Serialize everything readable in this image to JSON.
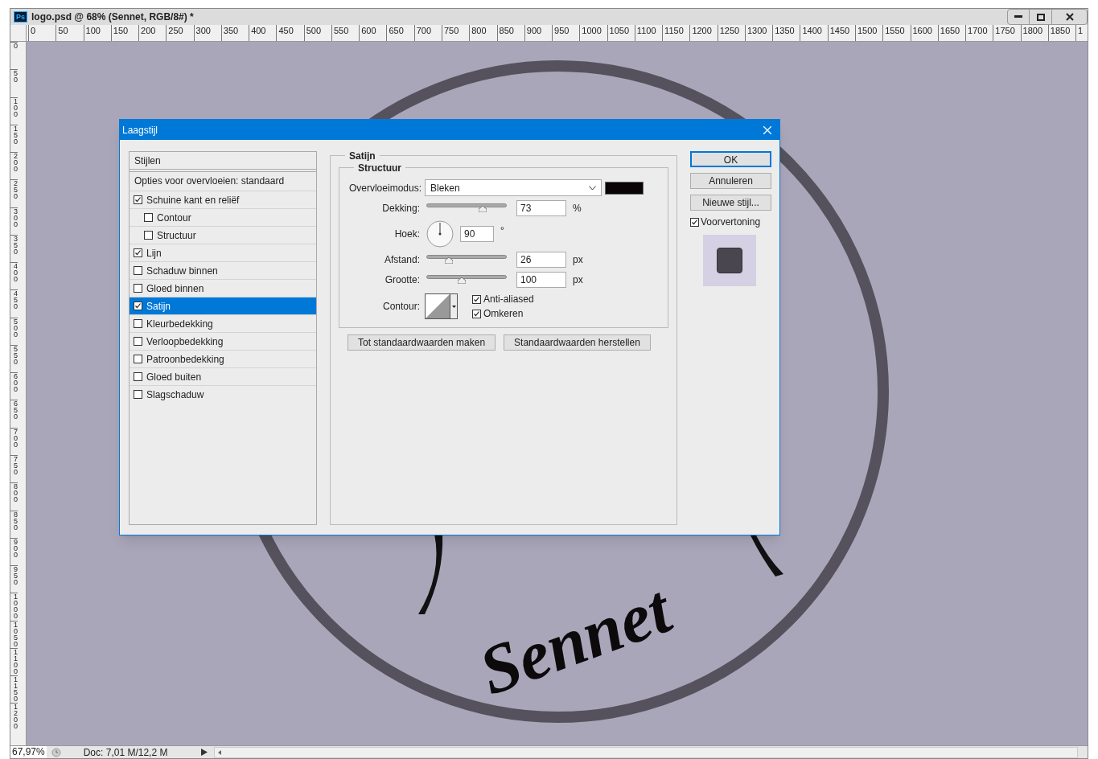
{
  "window": {
    "app_badge": "Ps",
    "title": "logo.psd @ 68% (Sennet, RGB/8#) *"
  },
  "rulers": {
    "horizontal": [
      "0",
      "50",
      "100",
      "150",
      "200",
      "250",
      "300",
      "350",
      "400",
      "450",
      "500",
      "550",
      "600",
      "650",
      "700",
      "750",
      "800",
      "850",
      "900",
      "950",
      "1000",
      "1050",
      "1100",
      "1150",
      "1200",
      "1250",
      "1300",
      "1350",
      "1400",
      "1450",
      "1500",
      "1550",
      "1600",
      "1650",
      "1700",
      "1750",
      "1800",
      "1850",
      "1"
    ],
    "vertical": [
      "0",
      "50",
      "100",
      "150",
      "200",
      "250",
      "300",
      "350",
      "400",
      "450",
      "500",
      "550",
      "600",
      "650",
      "700",
      "750",
      "800",
      "850",
      "900",
      "950",
      "1000",
      "1050",
      "1100",
      "1150",
      "1200"
    ]
  },
  "canvas": {
    "logo_text": "Sennet"
  },
  "dialog": {
    "title": "Laagstijl",
    "styles_header": "Stijlen",
    "blend_options": "Opties voor overvloeien: standaard",
    "effects": [
      {
        "label": "Schuine kant en reliëf",
        "checked": true,
        "selected": false,
        "children": [
          {
            "label": "Contour",
            "checked": false,
            "selected": false
          },
          {
            "label": "Structuur",
            "checked": false,
            "selected": false
          }
        ]
      },
      {
        "label": "Lijn",
        "checked": true,
        "selected": false
      },
      {
        "label": "Schaduw binnen",
        "checked": false,
        "selected": false
      },
      {
        "label": "Gloed binnen",
        "checked": false,
        "selected": false
      },
      {
        "label": "Satijn",
        "checked": true,
        "selected": true
      },
      {
        "label": "Kleurbedekking",
        "checked": false,
        "selected": false
      },
      {
        "label": "Verloopbedekking",
        "checked": false,
        "selected": false
      },
      {
        "label": "Patroonbedekking",
        "checked": false,
        "selected": false
      },
      {
        "label": "Gloed buiten",
        "checked": false,
        "selected": false
      },
      {
        "label": "Slagschaduw",
        "checked": false,
        "selected": false
      }
    ],
    "panel": {
      "title": "Satijn",
      "group": "Structuur",
      "blend_mode": {
        "label": "Overvloeimodus:",
        "value": "Bleken",
        "color": "#0a0406"
      },
      "opacity": {
        "label": "Dekking:",
        "level": 0.72,
        "value": "73",
        "unit": "%"
      },
      "angle": {
        "label": "Hoek:",
        "value": "90",
        "unit": "°"
      },
      "distance": {
        "label": "Afstand:",
        "level": 0.25,
        "value": "26",
        "unit": "px"
      },
      "size": {
        "label": "Grootte:",
        "level": 0.43,
        "value": "100",
        "unit": "px"
      },
      "contour": {
        "label": "Contour:"
      },
      "anti_aliased": {
        "label": "Anti-aliased",
        "checked": true
      },
      "invert": {
        "label": "Omkeren",
        "checked": true
      },
      "buttons": [
        "Tot standaardwaarden maken",
        "Standaardwaarden herstellen"
      ]
    },
    "actions": [
      {
        "label": "OK",
        "selected": true
      },
      {
        "label": "Annuleren",
        "selected": false
      },
      {
        "label": "Nieuwe stijl...",
        "selected": false
      }
    ],
    "preview": {
      "label": "Voorvertoning",
      "checked": true
    }
  },
  "status_bar": {
    "zoom": "67,97%",
    "doc": "Doc: 7,01 M/12,2 M"
  }
}
